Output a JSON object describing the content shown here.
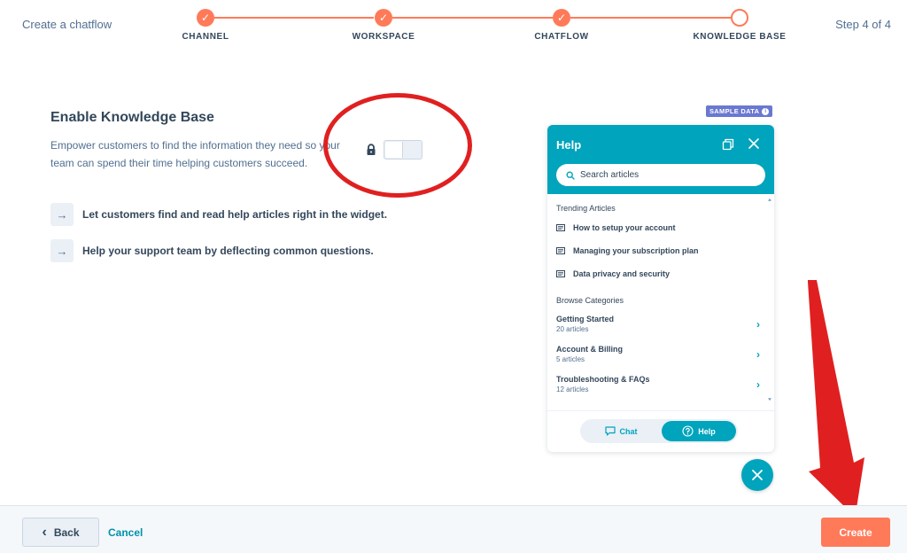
{
  "header": {
    "title": "Create a chatflow",
    "step_indicator": "Step 4 of 4"
  },
  "stepper": {
    "steps": [
      {
        "label": "CHANNEL",
        "state": "complete"
      },
      {
        "label": "WORKSPACE",
        "state": "complete"
      },
      {
        "label": "CHATFLOW",
        "state": "complete"
      },
      {
        "label": "KNOWLEDGE BASE",
        "state": "current"
      }
    ],
    "check_glyph": "✓"
  },
  "main": {
    "title": "Enable Knowledge Base",
    "description": "Empower customers to find the information they need so your team can spend their time helping customers succeed.",
    "toggle_state": "off",
    "toggle_locked": true,
    "arrow_glyph": "→",
    "benefits": [
      "Let customers find and read help articles right in the widget.",
      "Help your support team by deflecting common questions."
    ]
  },
  "preview": {
    "badge": "SAMPLE DATA",
    "badge_info_glyph": "i",
    "widget": {
      "title": "Help",
      "search_placeholder": "Search articles",
      "trending_label": "Trending Articles",
      "articles": [
        "How to setup your account",
        "Managing your subscription plan",
        "Data privacy and security"
      ],
      "browse_label": "Browse Categories",
      "categories": [
        {
          "name": "Getting Started",
          "count": "20 articles"
        },
        {
          "name": "Account & Billing",
          "count": "5 articles"
        },
        {
          "name": "Troubleshooting & FAQs",
          "count": "12 articles"
        }
      ],
      "chevron_glyph": "›",
      "tabs": {
        "chat": "Chat",
        "help": "Help",
        "selected": "help"
      }
    }
  },
  "footer": {
    "back_label": "Back",
    "back_glyph": "‹",
    "cancel_label": "Cancel",
    "create_label": "Create"
  },
  "colors": {
    "accent": "#ff7a59",
    "widget": "#00a4bd",
    "text": "#33475b",
    "link": "#0091ae",
    "annotation": "#e02020"
  }
}
